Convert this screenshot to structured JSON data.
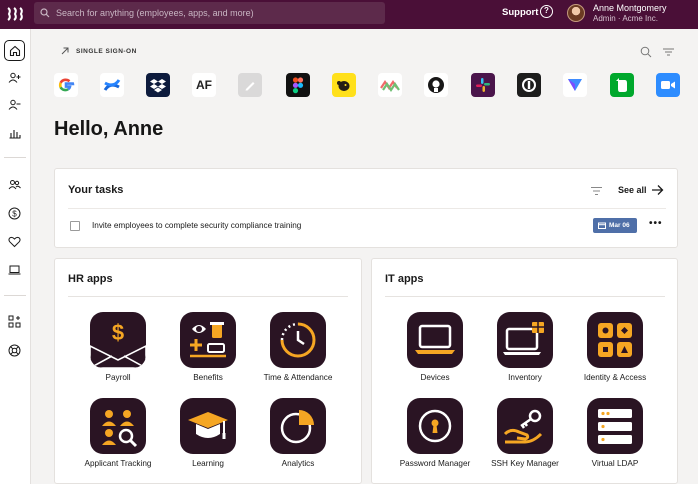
{
  "header": {
    "search_placeholder": "Search for anything (employees, apps, and more)",
    "support_label": "Support",
    "help_label": "?",
    "user_name": "Anne Montgomery",
    "user_subtitle": "Admin · Acme Inc."
  },
  "sidebar": {
    "items": [
      "home-icon",
      "add-person-icon",
      "remove-person-icon",
      "bar-chart-icon",
      "team-icon",
      "dollar-icon",
      "heart-icon",
      "laptop-icon",
      "apps-plus-icon",
      "lifebuoy-icon"
    ],
    "active": "home-icon"
  },
  "sso": {
    "label": "SINGLE SIGN-ON",
    "apps": [
      "google-icon",
      "confluence-icon",
      "dropbox-icon",
      "af-icon",
      "pen-icon",
      "figma-icon",
      "mailchimp-icon",
      "zigzag-icon",
      "github-icon",
      "slack-icon",
      "circle-app-icon",
      "triangle-app-icon",
      "evernote-icon",
      "zoom-icon"
    ],
    "af_text": "AF"
  },
  "greeting": "Hello, Anne",
  "tasks": {
    "title": "Your tasks",
    "see_all": "See all",
    "items": [
      {
        "text": "Invite employees to complete security compliance training",
        "due": "Mar 06",
        "more": "•••"
      }
    ]
  },
  "hr_apps": {
    "title": "HR apps",
    "apps": [
      {
        "label": "Payroll",
        "icon": "payroll-icon"
      },
      {
        "label": "Benefits",
        "icon": "benefits-icon"
      },
      {
        "label": "Time & Attendance",
        "icon": "clock-icon"
      },
      {
        "label": "Applicant Tracking",
        "icon": "applicant-icon"
      },
      {
        "label": "Learning",
        "icon": "graduation-cap-icon"
      },
      {
        "label": "Analytics",
        "icon": "pie-chart-icon"
      }
    ]
  },
  "it_apps": {
    "title": "IT apps",
    "apps": [
      {
        "label": "Devices",
        "icon": "laptop-icon"
      },
      {
        "label": "Inventory",
        "icon": "inventory-icon"
      },
      {
        "label": "Identity & Access",
        "icon": "grid-icon"
      },
      {
        "label": "Password Manager",
        "icon": "lock-icon"
      },
      {
        "label": "SSH Key Manager",
        "icon": "key-icon"
      },
      {
        "label": "Virtual LDAP",
        "icon": "server-icon"
      }
    ]
  },
  "colors": {
    "brand": "#4a0f37",
    "accent": "#f5a623",
    "tile": "#2a1423",
    "due_badge": "#4f6fa8"
  }
}
